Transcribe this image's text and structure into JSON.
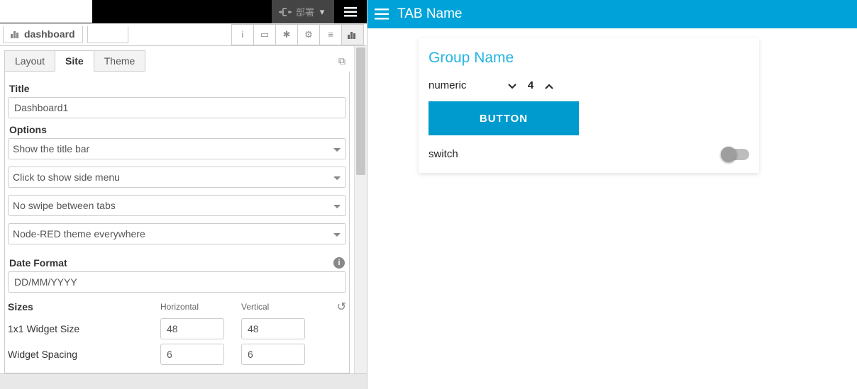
{
  "topbar": {
    "deploy_label": "部署"
  },
  "editor": {
    "node_label": "dashboard"
  },
  "tabs": {
    "layout": "Layout",
    "site": "Site",
    "theme": "Theme"
  },
  "form": {
    "title_label": "Title",
    "title_value": "Dashboard1",
    "options_label": "Options",
    "opt_titlebar": "Show the title bar",
    "opt_sidemenu": "Click to show side menu",
    "opt_swipe": "No swipe between tabs",
    "opt_theme": "Node-RED theme everywhere",
    "dateformat_label": "Date Format",
    "dateformat_value": "DD/MM/YYYY",
    "sizes_label": "Sizes",
    "col_horizontal": "Horizontal",
    "col_vertical": "Vertical",
    "row1_label": "1x1 Widget Size",
    "row1_h": "48",
    "row1_v": "48",
    "row2_label": "Widget Spacing",
    "row2_h": "6",
    "row2_v": "6"
  },
  "dashboard": {
    "tab_name": "TAB Name",
    "group_name": "Group Name",
    "numeric_label": "numeric",
    "numeric_value": "4",
    "button_label": "BUTTON",
    "switch_label": "switch"
  }
}
